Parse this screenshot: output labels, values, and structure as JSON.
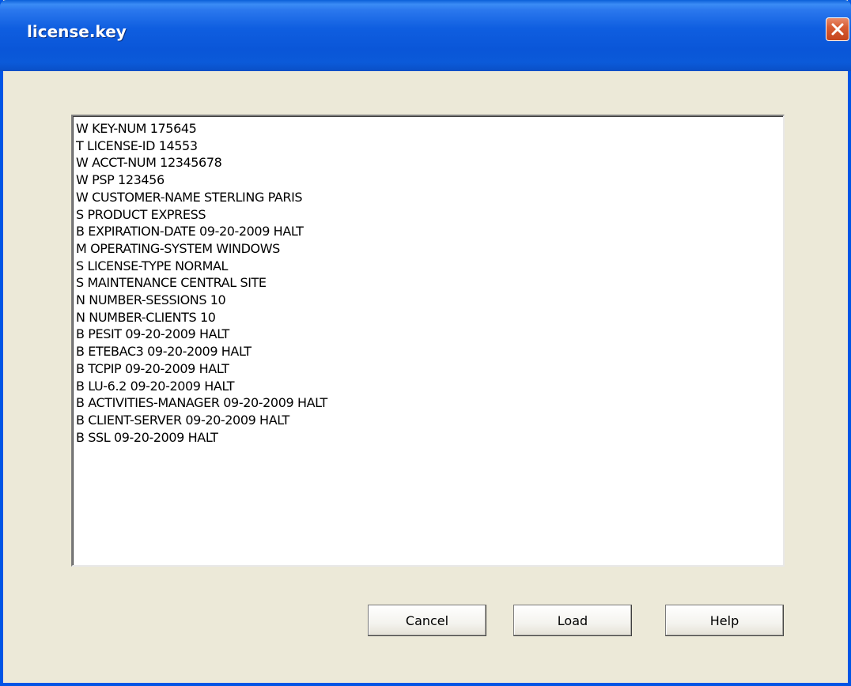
{
  "window": {
    "title": "license.key"
  },
  "titlebar": {
    "close_icon": "close-icon"
  },
  "license_text": {
    "lines": [
      "W KEY-NUM 175645",
      "T LICENSE-ID 14553",
      "W ACCT-NUM 12345678",
      "W PSP 123456",
      "W CUSTOMER-NAME STERLING PARIS",
      "S PRODUCT EXPRESS",
      "B EXPIRATION-DATE 09-20-2009 HALT",
      "M OPERATING-SYSTEM WINDOWS",
      "S LICENSE-TYPE NORMAL",
      "S MAINTENANCE CENTRAL SITE",
      "N NUMBER-SESSIONS 10",
      "N NUMBER-CLIENTS 10",
      "B PESIT 09-20-2009 HALT",
      "B ETEBAC3 09-20-2009 HALT",
      "B TCPIP 09-20-2009 HALT",
      "B LU-6.2 09-20-2009 HALT",
      "B ACTIVITIES-MANAGER 09-20-2009 HALT",
      "B CLIENT-SERVER 09-20-2009 HALT",
      "B SSL 09-20-2009 HALT"
    ]
  },
  "buttons": {
    "cancel_label": "Cancel",
    "load_label": "Load",
    "help_label": "Help"
  },
  "colors": {
    "titlebar": "#0a56d8",
    "window_bg": "#ece9d8",
    "close_button": "#d85c33"
  }
}
